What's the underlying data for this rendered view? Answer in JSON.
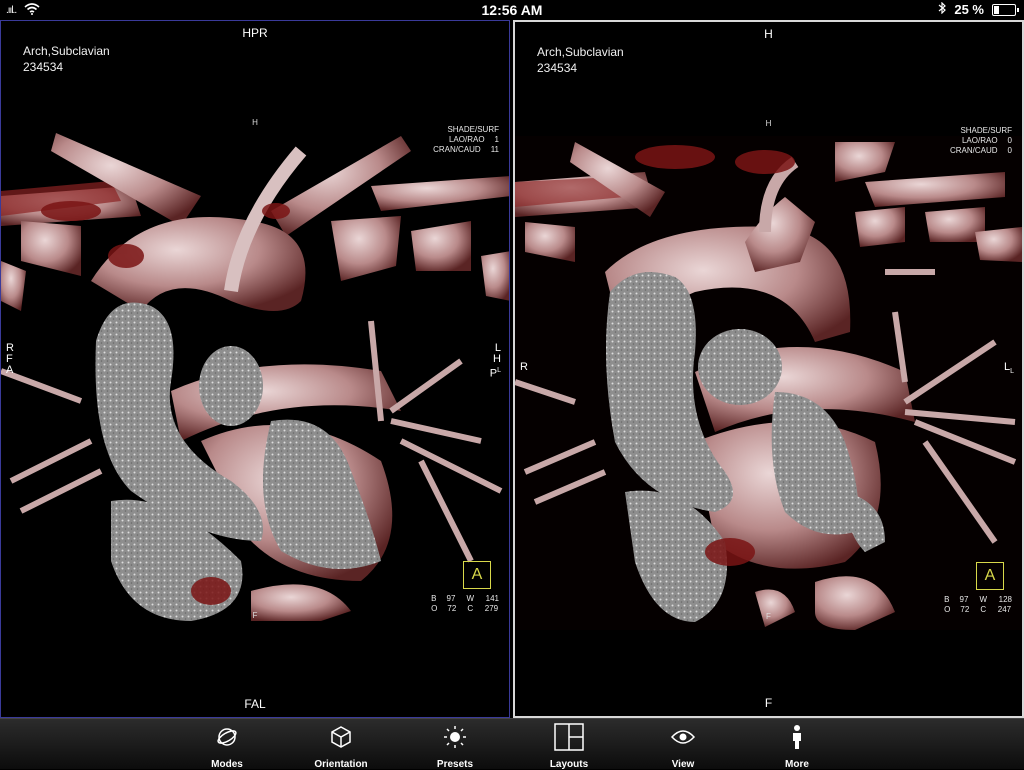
{
  "status_bar": {
    "carrier": ".ııl..",
    "time": "12:56 AM",
    "battery": "25 %",
    "battery_level": 0.25
  },
  "viewports": [
    {
      "label_top": "HPR",
      "label_bottom": "FAL",
      "patient_name": "Arch,Subclavian",
      "patient_id": "234534",
      "inner_top": "H",
      "inner_bottom": "F",
      "left_labels": [
        "R",
        "F",
        "A"
      ],
      "right_labels": [
        "L",
        "H",
        "P"
      ],
      "right_suffix": "L",
      "render_rows": [
        {
          "label": "SHADE/SURF",
          "value": ""
        },
        {
          "label": "LAO/RAO",
          "value": "1"
        },
        {
          "label": "CRAN/CAUD",
          "value": "11"
        }
      ],
      "wl_rows": [
        {
          "a": "B",
          "av": "97",
          "b": "W",
          "bv": "141"
        },
        {
          "a": "O",
          "av": "72",
          "b": "C",
          "bv": "279"
        }
      ],
      "cube_letter": "A"
    },
    {
      "label_top": "H",
      "label_bottom": "F",
      "patient_name": "Arch,Subclavian",
      "patient_id": "234534",
      "inner_top": "H",
      "inner_bottom": "F",
      "left_labels": [
        "R"
      ],
      "right_labels": [
        "L"
      ],
      "right_suffix": "L",
      "render_rows": [
        {
          "label": "SHADE/SURF",
          "value": ""
        },
        {
          "label": "LAO/RAO",
          "value": "0"
        },
        {
          "label": "CRAN/CAUD",
          "value": "0"
        }
      ],
      "wl_rows": [
        {
          "a": "B",
          "av": "97",
          "b": "W",
          "bv": "128"
        },
        {
          "a": "O",
          "av": "72",
          "b": "C",
          "bv": "247"
        }
      ],
      "cube_letter": "A"
    }
  ],
  "toolbar": {
    "modes": "Modes",
    "orientation": "Orientation",
    "presets": "Presets",
    "layouts": "Layouts",
    "view": "View",
    "more": "More"
  },
  "colors": {
    "vessel": "#c9a3a3",
    "contrast": "#9a9a9a",
    "blood": "#8a1a1a",
    "selected_border": "#d8d8d8",
    "inactive_border": "#3a3a9a"
  }
}
